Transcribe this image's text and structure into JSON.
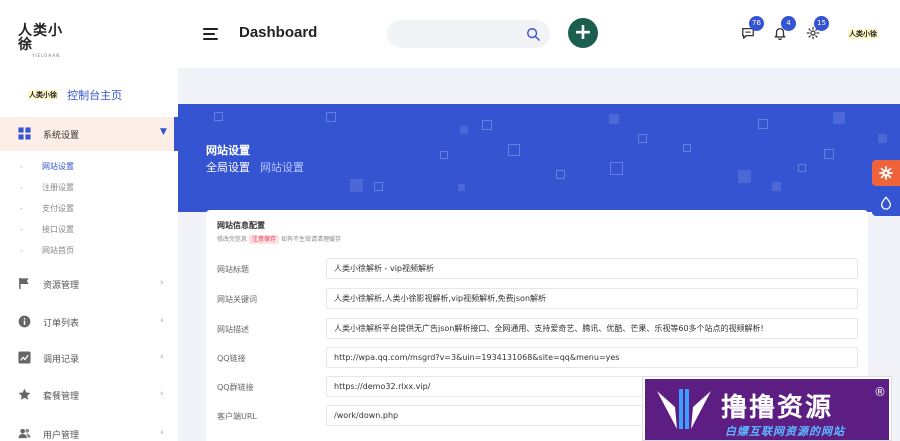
{
  "brand": {
    "logo_text": "人类小徐",
    "logo_sub": "YIELOHAN",
    "mini_logo": "人类小徐"
  },
  "header": {
    "title": "Dashboard",
    "search_placeholder": "",
    "badges": {
      "messages": "76",
      "notifications": "4",
      "settings": "15"
    }
  },
  "sidebar": {
    "home_label": "控制台主页",
    "menu": [
      {
        "label": "系统设置"
      },
      {
        "label": "资源管理"
      },
      {
        "label": "订单列表"
      },
      {
        "label": "调用记录"
      },
      {
        "label": "套餐管理"
      },
      {
        "label": "用户管理"
      }
    ],
    "submenu": [
      "网站设置",
      "注册设置",
      "支付设置",
      "接口设置",
      "网站首页"
    ]
  },
  "banner": {
    "title": "网站设置",
    "crumb1": "全局设置",
    "crumb2": "网站设置"
  },
  "form": {
    "section_title": "网站信息配置",
    "hint_before": "修改完信息",
    "hint_tag": "注意保存",
    "hint_after": "如有不生效请清理缓存",
    "rows": [
      {
        "label": "网站标题",
        "value": "人类小徐解析 - vip视频解析"
      },
      {
        "label": "网站关键词",
        "value": "人类小徐解析,人类小徐影视解析,vip视频解析,免费json解析"
      },
      {
        "label": "网站描述",
        "value": "人类小徐解析平台提供无广告json解析接口、全网通用、支持爱奇艺、腾讯、优酷、芒果、乐视等60多个站点的视频解析!"
      },
      {
        "label": "QQ链接",
        "value": "http://wpa.qq.com/msgrd?v=3&uin=1934131068&site=qq&menu=yes"
      },
      {
        "label": "QQ群链接",
        "value": "https://demo32.rlxx.vip/"
      },
      {
        "label": "客户端URL",
        "value": "/work/down.php"
      }
    ]
  },
  "watermark": {
    "title": "撸撸资源",
    "reg": "®",
    "subtitle": "白嫖互联网资源的网站"
  },
  "colors": {
    "primary": "#3454d1",
    "add_button": "#1b5e4f",
    "fab_orange": "#f06239",
    "watermark_bg": "#5d1e84"
  }
}
